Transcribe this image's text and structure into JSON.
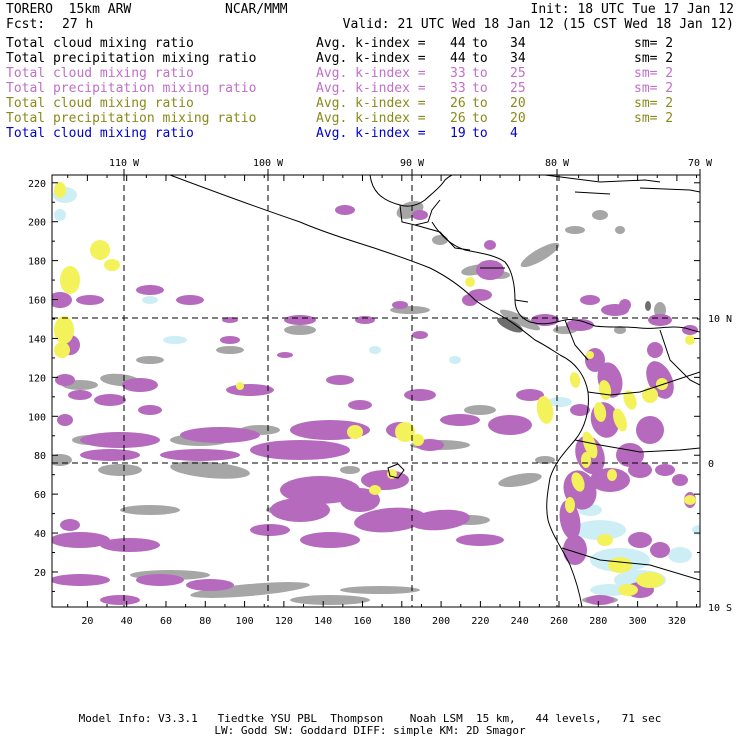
{
  "header": {
    "model": "TORERO  15km ARW",
    "org": "NCAR/MMM",
    "init": "Init: 18 UTC Tue 17 Jan 12",
    "fcst_label": "Fcst:",
    "fcst_value": "27 h",
    "valid": "Valid: 21 UTC Wed 18 Jan 12 (15 CST Wed 18 Jan 12)"
  },
  "fields": [
    {
      "name": "Total cloud mixing ratio",
      "index_label": "Avg. k-index =",
      "from": "44",
      "to_word": "to",
      "to": "34",
      "sm": "sm= 2",
      "color": "#000000"
    },
    {
      "name": "Total precipitation mixing ratio",
      "index_label": "Avg. k-index =",
      "from": "44",
      "to_word": "to",
      "to": "34",
      "sm": "sm= 2",
      "color": "#000000"
    },
    {
      "name": "Total cloud mixing ratio",
      "index_label": "Avg. k-index =",
      "from": "33",
      "to_word": "to",
      "to": "25",
      "sm": "sm= 2",
      "color": "#c070c8"
    },
    {
      "name": "Total precipitation mixing ratio",
      "index_label": "Avg. k-index =",
      "from": "33",
      "to_word": "to",
      "to": "25",
      "sm": "sm= 2",
      "color": "#c070c8"
    },
    {
      "name": "Total cloud mixing ratio",
      "index_label": "Avg. k-index =",
      "from": "26",
      "to_word": "to",
      "to": "20",
      "sm": "sm= 2",
      "color": "#8a8a1a"
    },
    {
      "name": "Total precipitation mixing ratio",
      "index_label": "Avg. k-index =",
      "from": "26",
      "to_word": "to",
      "to": "20",
      "sm": "sm= 2",
      "color": "#8a8a1a"
    },
    {
      "name": "Total cloud mixing ratio",
      "index_label": "Avg. k-index =",
      "from": "19",
      "to_word": "to",
      "to": "4",
      "sm": "",
      "color": "#0000d0"
    }
  ],
  "map": {
    "top_lon_labels": [
      "110 W",
      "100 W",
      "90 W",
      "80 W",
      "70 W"
    ],
    "right_lat_labels": [
      "10 N",
      "0",
      "10 S"
    ],
    "left_ticks": [
      "220",
      "200",
      "180",
      "160",
      "140",
      "120",
      "100",
      "80",
      "60",
      "40",
      "20"
    ],
    "bottom_ticks": [
      "20",
      "40",
      "60",
      "80",
      "100",
      "120",
      "140",
      "160",
      "180",
      "200",
      "220",
      "240",
      "260",
      "280",
      "300",
      "320"
    ],
    "colors": {
      "gray": "#a6a6a6",
      "dark_gray": "#6e6e6e",
      "purple": "#b56abd",
      "yellow": "#f4f25a",
      "light_blue": "#cdeef5",
      "coast": "#000000",
      "grid": "#000000"
    }
  },
  "footer": {
    "line1": "Model Info: V3.3.1   Tiedtke YSU PBL  Thompson    Noah LSM  15 km,   44 levels,   71 sec",
    "line2": "LW: Godd SW: Goddard DIFF: simple KM: 2D Smagor"
  }
}
